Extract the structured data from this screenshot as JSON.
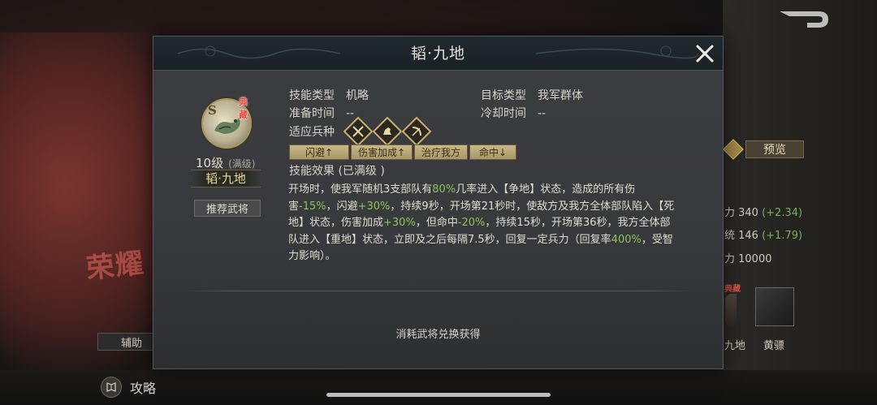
{
  "background": {
    "logo_text": "荣耀",
    "assist_tab": "辅助",
    "guide_label": "攻略",
    "preview_button": "预览",
    "stats": [
      {
        "label": "力 340",
        "plus": "(+2.34)"
      },
      {
        "label": "统 146",
        "plus": "(+1.79)"
      },
      {
        "label": "力 10000",
        "plus": ""
      }
    ],
    "bg_badge": "典藏",
    "names": [
      "九地",
      "黄骠"
    ]
  },
  "modal": {
    "title": "韬·九地",
    "skill": {
      "badge": "典藏",
      "grade": "S",
      "level": "10级",
      "level_note": "(满级)",
      "name": "韬·九地"
    },
    "recommend_button": "推荐武将",
    "info": {
      "skill_type_label": "技能类型",
      "skill_type_value": "机略",
      "target_type_label": "目标类型",
      "target_type_value": "我军群体",
      "prep_time_label": "准备时间",
      "prep_time_value": "--",
      "cooldown_label": "冷却时间",
      "cooldown_value": "--",
      "troop_label": "适应兵种"
    },
    "troop_icons": [
      "spear-troop-icon",
      "cavalry-troop-icon",
      "archer-troop-icon"
    ],
    "tags": [
      "闪避↑",
      "伤害加成↑",
      "治疗我方",
      "命中↓"
    ],
    "effect_title": "技能效果 (已满级 )",
    "effect_parts": [
      {
        "t": "开场时，使我军随机3支部队有",
        "hl": false
      },
      {
        "t": "80%",
        "hl": true
      },
      {
        "t": "几率进入【争地】状态，造成的所有伤害",
        "hl": false
      },
      {
        "t": "-15%",
        "hl": true
      },
      {
        "t": "，闪避",
        "hl": false
      },
      {
        "t": "+30%",
        "hl": true
      },
      {
        "t": "，持续9秒，开场第21秒时，使敌方及我方全体部队陷入【死地】状态，伤害加成",
        "hl": false
      },
      {
        "t": "+30%",
        "hl": true
      },
      {
        "t": "，但命中",
        "hl": false
      },
      {
        "t": "-20%",
        "hl": true
      },
      {
        "t": "，持续15秒，开场第36秒，我方全体部队进入【重地】状态，立即及之后每隔7.5秒，回复一定兵力（回复率",
        "hl": false
      },
      {
        "t": "400%",
        "hl": true
      },
      {
        "t": "，受智力影响）。",
        "hl": false
      }
    ],
    "obtain_text": "消耗武将兑换获得"
  },
  "colors": {
    "highlight_green": "#8bc45a",
    "tag_bg": "#c8b888",
    "badge_red": "#e84a3a",
    "name_gold": "#e8d89a"
  }
}
